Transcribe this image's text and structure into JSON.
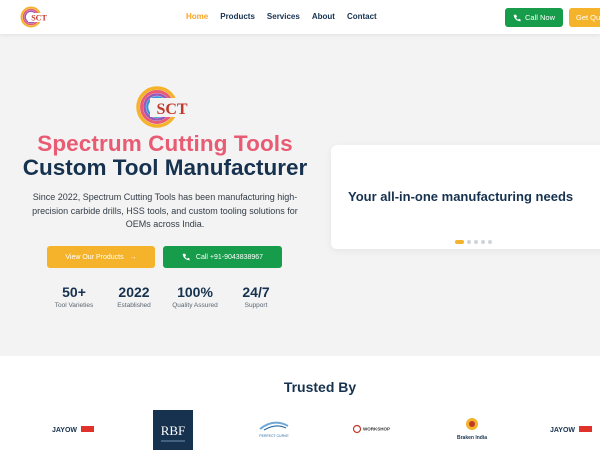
{
  "header": {
    "logo_text": "SCT",
    "nav": [
      {
        "label": "Home",
        "active": true
      },
      {
        "label": "Products",
        "active": false
      },
      {
        "label": "Services",
        "active": false
      },
      {
        "label": "About",
        "active": false
      },
      {
        "label": "Contact",
        "active": false
      }
    ],
    "call_label": "Call Now",
    "quote_label": "Get Quote"
  },
  "hero": {
    "logo_text": "SCT",
    "title_line1": "Spectrum Cutting Tools",
    "title_line2": "Custom Tool Manufacturer",
    "description": "Since 2022, Spectrum Cutting Tools has been manufacturing high-precision carbide drills, HSS tools, and custom tooling solutions for OEMs across India.",
    "products_button": "View Our Products",
    "call_button": "Call +91-9043838967",
    "stats": [
      {
        "value": "50+",
        "label": "Tool Varieties"
      },
      {
        "value": "2022",
        "label": "Established"
      },
      {
        "value": "100%",
        "label": "Quality Assured"
      },
      {
        "value": "24/7",
        "label": "Support"
      }
    ]
  },
  "carousel": {
    "text": "Your all-in-one manufacturing needs",
    "slide_count": 5,
    "active_index": 0
  },
  "trusted": {
    "title": "Trusted By",
    "partners": [
      {
        "name": "JAYOW"
      },
      {
        "name": "RBF"
      },
      {
        "name": "PERFECT CURVE"
      },
      {
        "name": "WORKSHOP"
      },
      {
        "name": "Braken India"
      },
      {
        "name": "JAYOW"
      }
    ]
  },
  "colors": {
    "navy": "#16324f",
    "pink": "#e85b73",
    "amber": "#f4b32a",
    "green": "#169c4a",
    "hero_bg": "#f3f3f3"
  }
}
